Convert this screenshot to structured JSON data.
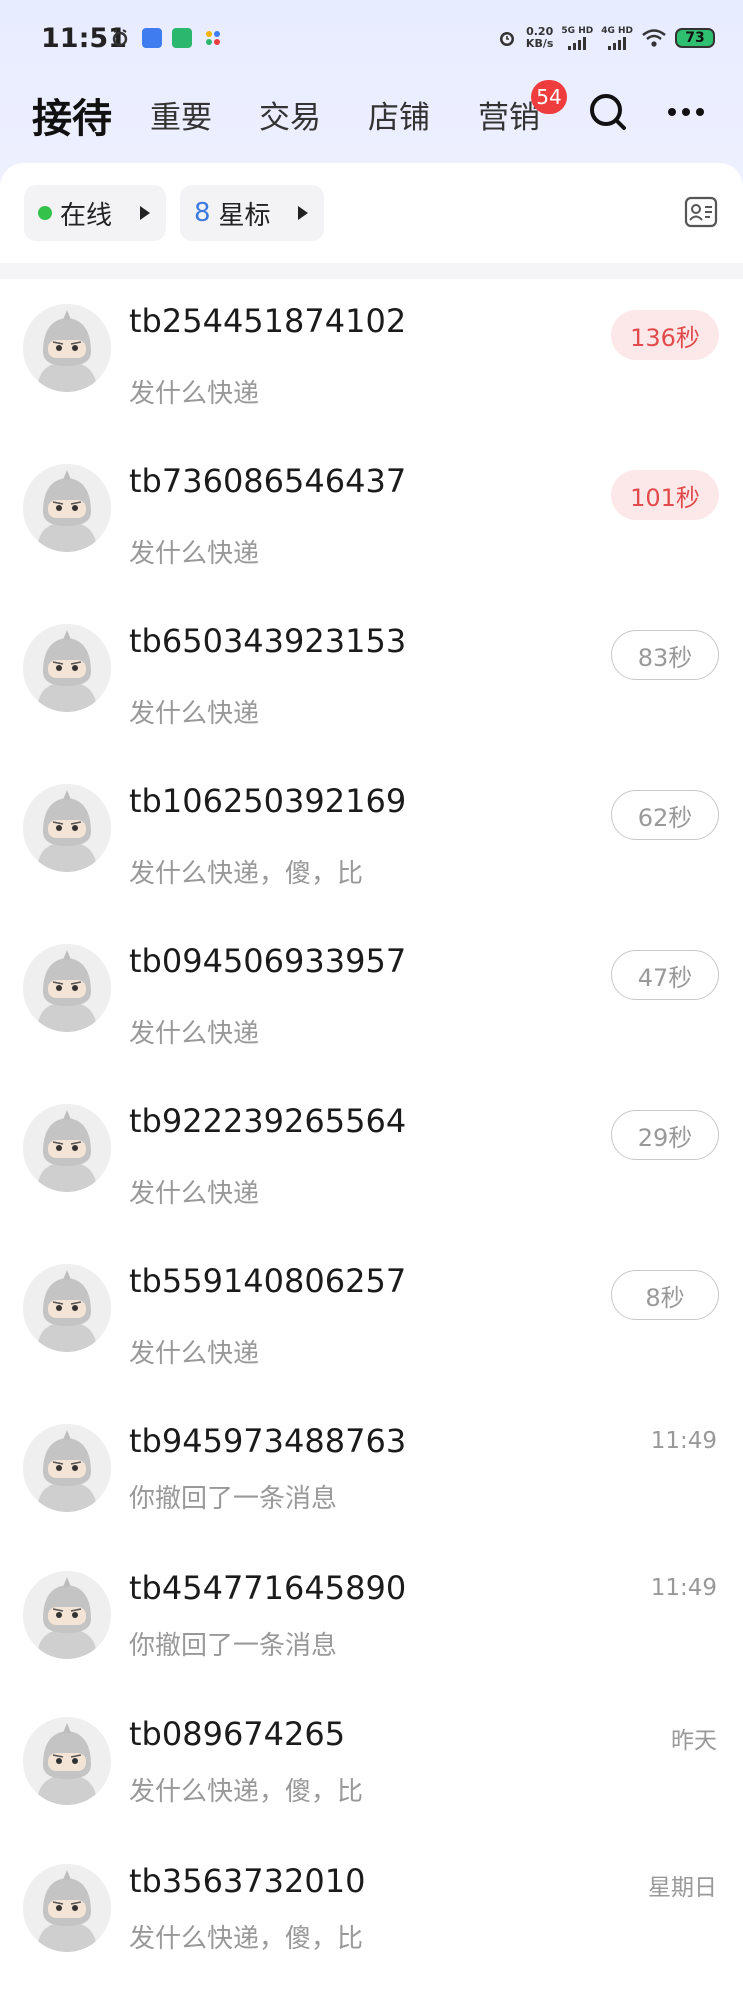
{
  "status_bar": {
    "time": "11:51",
    "net_speed_value": "0.20",
    "net_speed_unit": "KB/s",
    "sig1": "5G HD",
    "sig2": "4G HD",
    "battery": "73"
  },
  "tabs": [
    {
      "label": "接待",
      "active": true
    },
    {
      "label": "重要"
    },
    {
      "label": "交易"
    },
    {
      "label": "店铺"
    },
    {
      "label": "营销",
      "badge": "54"
    }
  ],
  "filters": {
    "online_label": "在线",
    "star_count": "8",
    "star_label": "星标"
  },
  "conversations": [
    {
      "name": "tb254451874102",
      "message": "发什么快递",
      "timer": "136秒",
      "urgent": true
    },
    {
      "name": "tb736086546437",
      "message": "发什么快递",
      "timer": "101秒",
      "urgent": true
    },
    {
      "name": "tb650343923153",
      "message": "发什么快递",
      "timer": "83秒",
      "urgent": false
    },
    {
      "name": "tb106250392169",
      "message": "发什么快递，傻，比",
      "timer": "62秒",
      "urgent": false
    },
    {
      "name": "tb094506933957",
      "message": "发什么快递",
      "timer": "47秒",
      "urgent": false
    },
    {
      "name": "tb922239265564",
      "message": "发什么快递",
      "timer": "29秒",
      "urgent": false
    },
    {
      "name": "tb559140806257",
      "message": "发什么快递",
      "timer": "8秒",
      "urgent": false
    },
    {
      "name": "tb945973488763",
      "message": "你撤回了一条消息",
      "time": "11:49"
    },
    {
      "name": "tb454771645890",
      "message": "你撤回了一条消息",
      "time": "11:49"
    },
    {
      "name": "tb089674265",
      "message": "发什么快递，傻，比",
      "time": "昨天"
    },
    {
      "name": "tb3563732010",
      "message": "发什么快递，傻，比",
      "time": "星期日"
    }
  ],
  "colors": {
    "accent_red": "#e14b4b",
    "online_green": "#35c24a",
    "star_blue": "#3d7be0"
  }
}
